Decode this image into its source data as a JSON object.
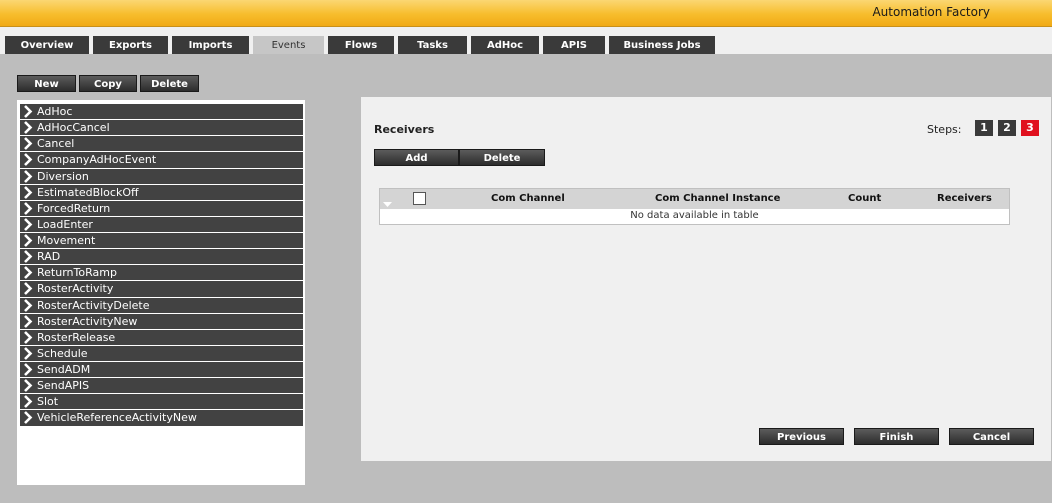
{
  "header": {
    "title": "Automation Factory"
  },
  "tabs": [
    {
      "label": "Overview"
    },
    {
      "label": "Exports"
    },
    {
      "label": "Imports"
    },
    {
      "label": "Events",
      "active": true
    },
    {
      "label": "Flows"
    },
    {
      "label": "Tasks"
    },
    {
      "label": "AdHoc"
    },
    {
      "label": "APIS"
    },
    {
      "label": "Business Jobs"
    }
  ],
  "toolbar": {
    "new_label": "New",
    "copy_label": "Copy",
    "delete_label": "Delete"
  },
  "events": [
    {
      "label": "AdHoc"
    },
    {
      "label": "AdHocCancel"
    },
    {
      "label": "Cancel"
    },
    {
      "label": "CompanyAdHocEvent"
    },
    {
      "label": "Diversion"
    },
    {
      "label": "EstimatedBlockOff"
    },
    {
      "label": "ForcedReturn"
    },
    {
      "label": "LoadEnter"
    },
    {
      "label": "Movement"
    },
    {
      "label": "RAD"
    },
    {
      "label": "ReturnToRamp"
    },
    {
      "label": "RosterActivity"
    },
    {
      "label": "RosterActivityDelete"
    },
    {
      "label": "RosterActivityNew"
    },
    {
      "label": "RosterRelease"
    },
    {
      "label": "Schedule"
    },
    {
      "label": "SendADM"
    },
    {
      "label": "SendAPIS"
    },
    {
      "label": "Slot"
    },
    {
      "label": "VehicleReferenceActivityNew"
    }
  ],
  "wizard": {
    "section_title": "Receivers",
    "steps_label": "Steps:",
    "steps": [
      {
        "label": "1"
      },
      {
        "label": "2"
      },
      {
        "label": "3",
        "active": true
      }
    ],
    "add_label": "Add",
    "delete_label": "Delete",
    "table": {
      "columns": [
        "Com Channel",
        "Com Channel Instance",
        "Count",
        "Receivers"
      ],
      "empty_message": "No data available in table"
    },
    "previous_label": "Previous",
    "finish_label": "Finish",
    "cancel_label": "Cancel"
  },
  "colors": {
    "header_gold": "#f7bd2c",
    "dark_button": "#3a3a3a",
    "active_step_red": "#e0101e",
    "panel_grey": "#bdbdbd"
  }
}
